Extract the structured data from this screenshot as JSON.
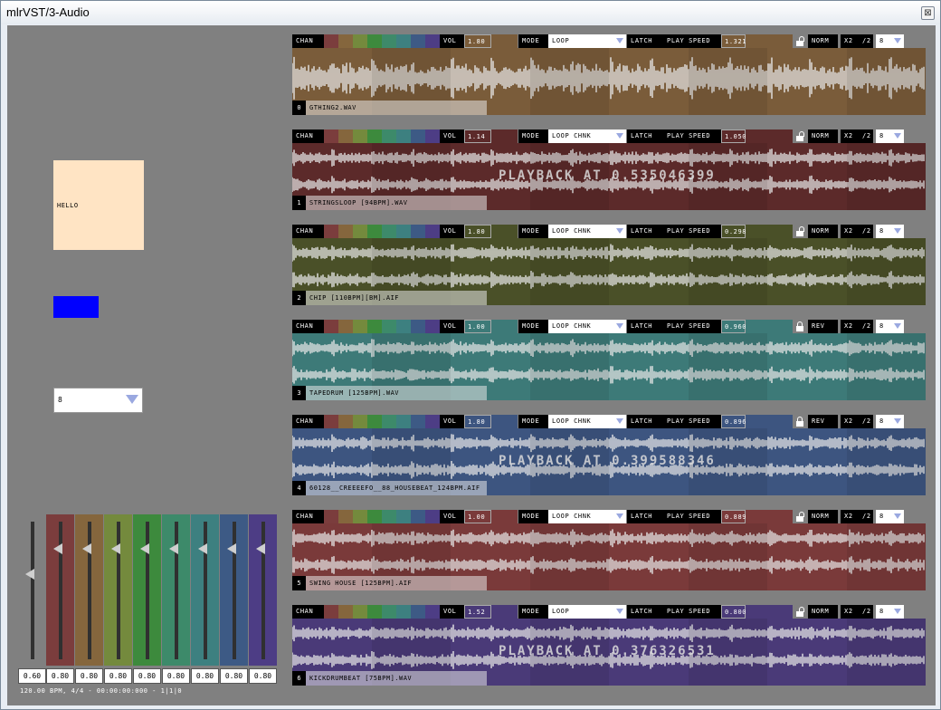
{
  "window": {
    "title": "mlrVST/3-Audio",
    "close_glyph": "⊠"
  },
  "left_panel": {
    "hello_label": "HELLO",
    "combo_value": "8",
    "blue_box_color": "#0000ff"
  },
  "faders": [
    {
      "value": "0.60",
      "color": "#808080"
    },
    {
      "value": "0.80",
      "color": "#7b3d3d"
    },
    {
      "value": "0.80",
      "color": "#85663d"
    },
    {
      "value": "0.80",
      "color": "#748a3d"
    },
    {
      "value": "0.80",
      "color": "#3d8a3d"
    },
    {
      "value": "0.80",
      "color": "#3d8a6a"
    },
    {
      "value": "0.80",
      "color": "#3d8080"
    },
    {
      "value": "0.80",
      "color": "#3d5a85"
    },
    {
      "value": "0.80",
      "color": "#4d3d85"
    }
  ],
  "status_bar": "120.00 BPM, 4/4  -  00:00:00:000  -  1|1|0",
  "labels": {
    "chan": "CHAN",
    "vol": "VOL",
    "mode": "MODE",
    "latch": "LATCH",
    "play_speed": "PLAY SPEED",
    "x2": "X2",
    "div2": "/2"
  },
  "channel_swatches": [
    "#7b3d3d",
    "#85663d",
    "#748a3d",
    "#3d8a3d",
    "#3d8a6a",
    "#3d8080",
    "#3d5a85",
    "#4d3d85"
  ],
  "strips": [
    {
      "index": "0",
      "vol": "1.80",
      "mode": "LOOP",
      "speed": "1.321",
      "dir": "NORM",
      "div": "8",
      "file": "GTHING2.WAV",
      "color": "#7a5c3a",
      "locked": false,
      "playback": ""
    },
    {
      "index": "1",
      "vol": "1.14",
      "mode": "LOOP CHNK",
      "speed": "1.050",
      "dir": "NORM",
      "div": "8",
      "file": "STRINGSLOOP [94BPM].WAV",
      "color": "#5c2a2a",
      "locked": false,
      "playback": "PLAYBACK AT 0.535046399"
    },
    {
      "index": "2",
      "vol": "1.80",
      "mode": "LOOP CHNK",
      "speed": "0.298",
      "dir": "NORM",
      "div": "8",
      "file": "CHIP [110BPM][BM].AIF",
      "color": "#4a5028",
      "locked": false,
      "playback": ""
    },
    {
      "index": "3",
      "vol": "1.00",
      "mode": "LOOP CHNK",
      "speed": "0.960",
      "dir": "REV",
      "div": "8",
      "file": "TAPEDRUM [125BPM].WAV",
      "color": "#3d7a78",
      "locked": true,
      "playback": ""
    },
    {
      "index": "4",
      "vol": "1.80",
      "mode": "LOOP CHNK",
      "speed": "0.896",
      "dir": "REV",
      "div": "8",
      "file": "60128__CREEEEFO__88_HOUSEBEAT_124BPM.AIF",
      "color": "#3d5580",
      "locked": true,
      "playback": "PLAYBACK AT 0.399588346"
    },
    {
      "index": "5",
      "vol": "1.00",
      "mode": "LOOP CHNK",
      "speed": "0.889",
      "dir": "NORM",
      "div": "8",
      "file": "SWING HOUSE [125BPM].AIF",
      "color": "#7a3a3a",
      "locked": false,
      "playback": ""
    },
    {
      "index": "6",
      "vol": "1.52",
      "mode": "LOOP",
      "speed": "0.800",
      "dir": "NORM",
      "div": "8",
      "file": "KICKDRUMBEAT [75BPM].WAV",
      "color": "#4a3a78",
      "locked": false,
      "playback": "PLAYBACK AT 0.376326531"
    }
  ]
}
